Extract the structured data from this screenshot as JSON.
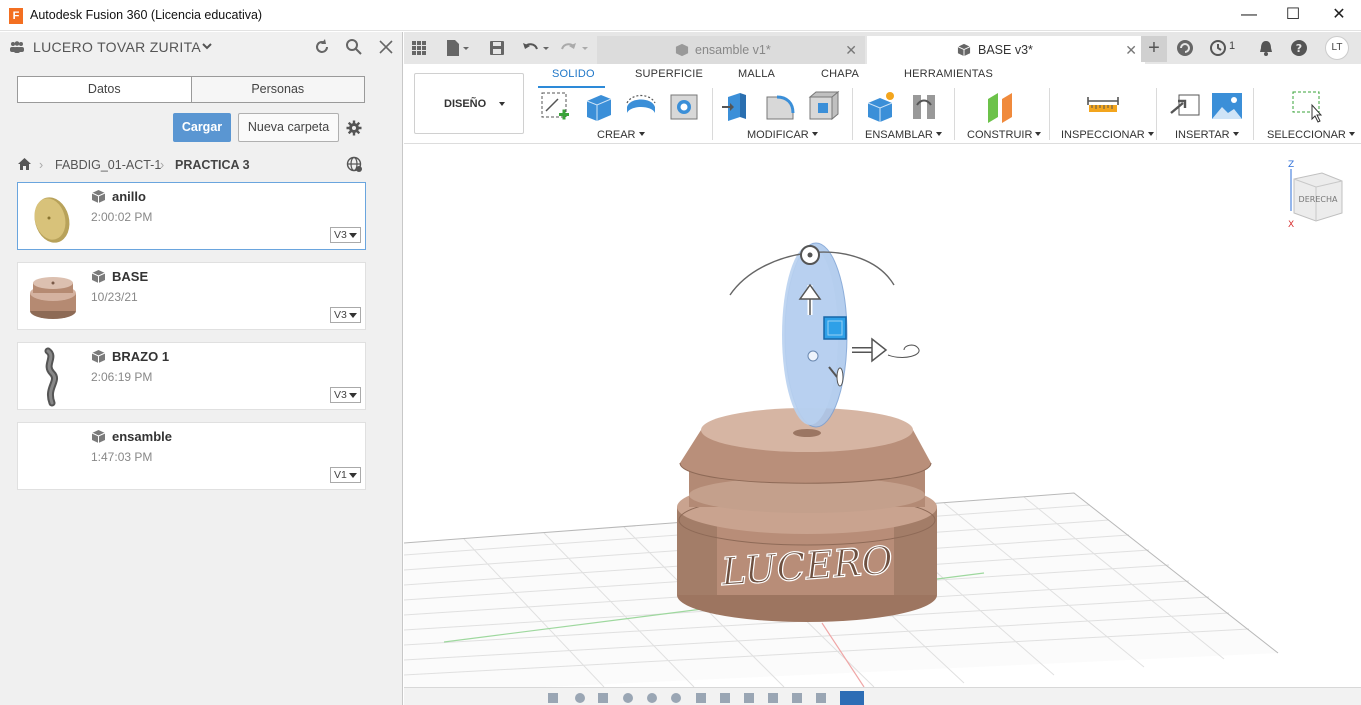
{
  "window": {
    "logo_letter": "F",
    "title": "Autodesk Fusion 360 (Licencia educativa)",
    "minimize": "—",
    "maximize": "☐",
    "close": "✕"
  },
  "datapanel": {
    "user": "LUCERO TOVAR ZURITA",
    "tabs": [
      "Datos",
      "Personas"
    ],
    "upload_label": "Cargar",
    "new_folder_label": "Nueva carpeta",
    "breadcrumb": [
      "FABDIG_01-ACT-1",
      "PRACTICA 3"
    ],
    "items": [
      {
        "name": "anillo",
        "date": "2:00:02 PM",
        "version": "V3"
      },
      {
        "name": "BASE",
        "date": "10/23/21",
        "version": "V3"
      },
      {
        "name": "BRAZO 1",
        "date": "2:06:19 PM",
        "version": "V3"
      },
      {
        "name": "ensamble",
        "date": "1:47:03 PM",
        "version": "V1"
      }
    ]
  },
  "tabbar": {
    "tabs": [
      {
        "label": "ensamble v1*",
        "active": false
      },
      {
        "label": "BASE v3*",
        "active": true
      }
    ],
    "jobs_count": "1",
    "avatar": "LT"
  },
  "ribbon": {
    "workspace": "DISEÑO",
    "tabs": [
      "SOLIDO",
      "SUPERFICIE",
      "MALLA",
      "CHAPA",
      "HERRAMIENTAS"
    ],
    "active_tab": "SOLIDO",
    "groups": [
      "CREAR",
      "MODIFICAR",
      "ENSAMBLAR",
      "CONSTRUIR",
      "INSPECCIONAR",
      "INSERTAR",
      "SELECCIONAR"
    ]
  },
  "viewport": {
    "viewcube_face": "DERECHA",
    "axis_z": "Z",
    "axis_x": "X",
    "engraved_text": "LUCERO"
  },
  "colors": {
    "accent": "#1f77c8",
    "primary_button": "#5a96d2",
    "body_bronze": "#c8a08c",
    "disk_blue": "#a9c6ec",
    "logo_orange": "#f36f21"
  }
}
